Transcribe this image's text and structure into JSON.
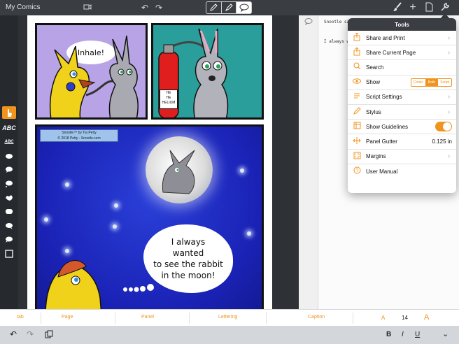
{
  "topbar": {
    "doc_title": "My Comics",
    "icons": [
      "video-icon",
      "undo-icon",
      "redo-icon",
      "pencil-icon",
      "pen-icon",
      "speech-bubble-icon",
      "brush-icon",
      "plus-icon",
      "page-icon",
      "wrench-icon"
    ]
  },
  "comic": {
    "panel1_bubble": "Inhale!",
    "tank_label_1": "HE",
    "tank_label_2": "HE",
    "tank_label_3": "HELIUM",
    "credit_line_1": "Snootle™ by Tia Petty",
    "credit_line_2": "© 2018 Petty - Snootle.com",
    "bubble_line_1": "I always",
    "bubble_line_2": "wanted",
    "bubble_line_3": "to see the rabbit",
    "bubble_line_4": "in the moon!"
  },
  "script": {
    "line1": "Snootle sa",
    "line2": "I always w"
  },
  "tools_menu": {
    "title": "Tools",
    "share_print": "Share and Print",
    "share_current": "Share Current Page",
    "search": "Search",
    "show": "Show",
    "show_options": [
      "Comic",
      "Both",
      "Script"
    ],
    "show_selected": "Both",
    "script_settings": "Script Settings",
    "stylus": "Stylus",
    "show_guidelines": "Show Guidelines",
    "show_guidelines_on": true,
    "panel_gutter": "Panel Gutter",
    "panel_gutter_value": "0.125 in",
    "margins": "Margins",
    "user_manual": "User Manual"
  },
  "bottom_tabs": {
    "tab": "tab",
    "page": "Page",
    "panel": "Panel",
    "lettering": "Lettering",
    "caption": "Caption",
    "font_small": "A",
    "font_size": "14",
    "font_large": "A"
  },
  "accessory": {
    "bold": "B",
    "italic": "I",
    "underline": "U"
  },
  "colors": {
    "accent": "#f0941e",
    "toolbar": "#3a3d42"
  }
}
